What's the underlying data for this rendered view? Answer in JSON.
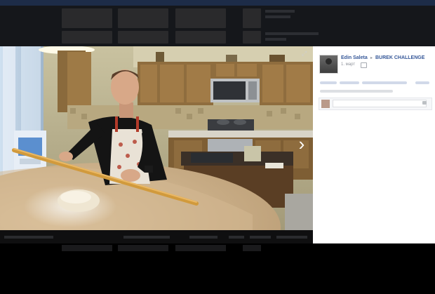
{
  "viewer": {
    "author": "Edin Saleta",
    "group": "BUREK CHALLENGE",
    "date": "1. март",
    "comment_placeholder": ""
  },
  "colors": {
    "link": "#365899",
    "stage_bg": "#000000",
    "panel_bg": "#ffffff",
    "backdrop": "#0c0c0d",
    "topbar": "#1d2c48"
  },
  "icons": [
    "expand-icon",
    "chevron-right-icon",
    "globe-icon",
    "camera-icon"
  ]
}
